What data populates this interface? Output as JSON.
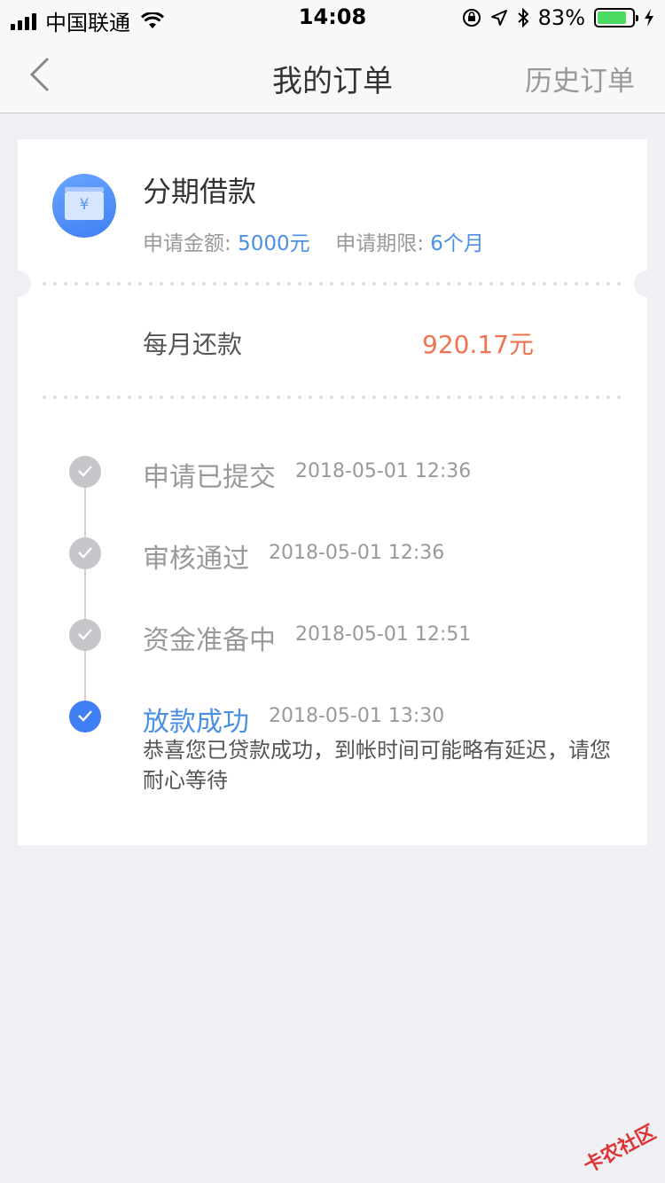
{
  "status_bar": {
    "carrier": "中国联通",
    "time": "14:08",
    "battery": "83%",
    "battery_level": 0.83
  },
  "nav": {
    "title": "我的订单",
    "history": "历史订单"
  },
  "loan": {
    "title": "分期借款",
    "amount_label": "申请金额:",
    "amount_value": "5000元",
    "term_label": "申请期限:",
    "term_value": "6个月",
    "icon_symbol": "¥"
  },
  "monthly": {
    "label": "每月还款",
    "value": "920.17元"
  },
  "timeline": {
    "steps": [
      {
        "name": "申请已提交",
        "time": "2018-05-01 12:36"
      },
      {
        "name": "审核通过",
        "time": "2018-05-01 12:36"
      },
      {
        "name": "资金准备中",
        "time": "2018-05-01 12:51"
      },
      {
        "name": "放款成功",
        "time": "2018-05-01 13:30"
      }
    ],
    "final_description": "恭喜您已贷款成功，到帐时间可能略有延迟，请您耐心等待"
  },
  "watermark": "卡农社区",
  "colors": {
    "accent": "#4a90e2",
    "amount": "#f07350",
    "inactive": "#c5c5ca"
  }
}
